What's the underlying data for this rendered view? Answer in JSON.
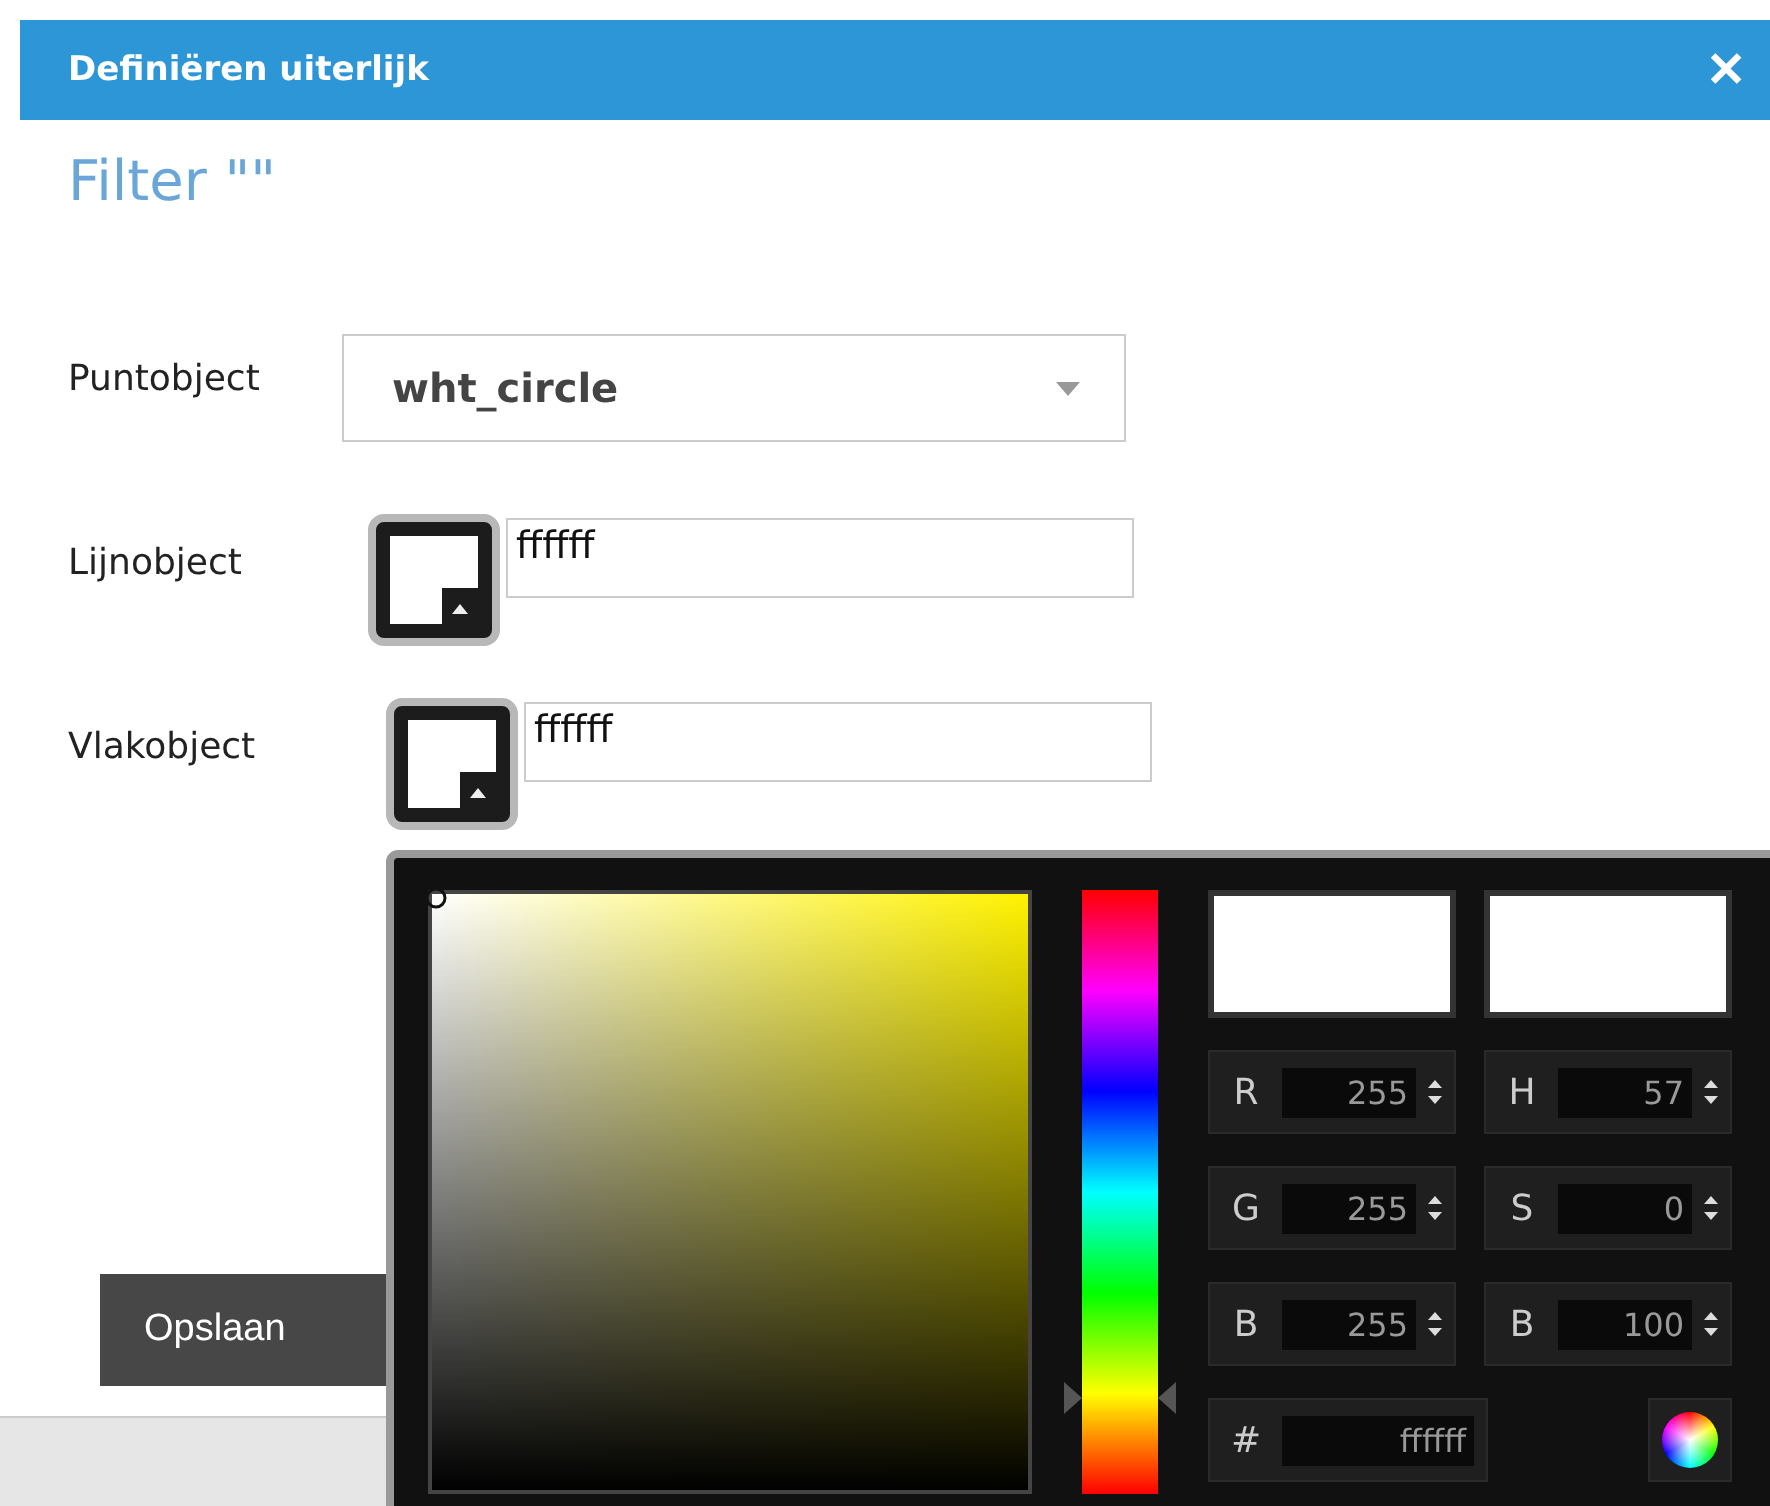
{
  "dialog": {
    "title": "Definiëren uiterlijk",
    "close": "✕"
  },
  "heading": "Filter \"\"",
  "fields": [
    {
      "kind": "select",
      "label": "Puntobject",
      "value": "wht_circle"
    },
    {
      "kind": "color",
      "label": "Lijnobject",
      "value": "ffffff"
    },
    {
      "kind": "color",
      "label": "Vlakobject",
      "value": "ffffff"
    }
  ],
  "save_button": "Opslaan",
  "picker": {
    "hue": {
      "level": 0.16
    },
    "channels": [
      {
        "label": "R",
        "value": "255"
      },
      {
        "label": "H",
        "value": "57"
      },
      {
        "label": "G",
        "value": "255"
      },
      {
        "label": "S",
        "value": "0"
      },
      {
        "label": "B",
        "value": "255"
      },
      {
        "label": "B",
        "value": "100"
      }
    ],
    "hex": {
      "label": "#",
      "value": "ffffff"
    }
  }
}
